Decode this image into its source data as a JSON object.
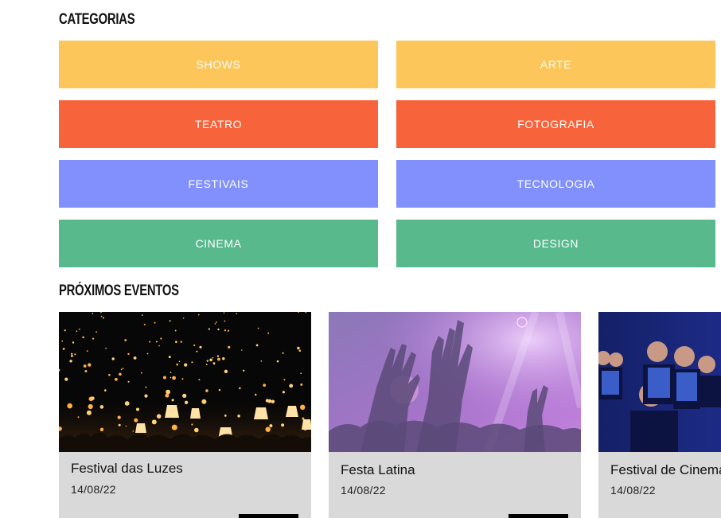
{
  "categories_section": {
    "title": "CATEGORIAS",
    "items": [
      {
        "label": "SHOWS",
        "color": "#fdc65a"
      },
      {
        "label": "ARTE",
        "color": "#fdc65a"
      },
      {
        "label": "TEATRO",
        "color": "#f7633a"
      },
      {
        "label": "FOTOGRAFIA",
        "color": "#f7633a"
      },
      {
        "label": "FESTIVAIS",
        "color": "#8190fd"
      },
      {
        "label": "TECNOLOGIA",
        "color": "#8190fd"
      },
      {
        "label": "CINEMA",
        "color": "#58b98c"
      },
      {
        "label": "DESIGN",
        "color": "#58b98c"
      }
    ]
  },
  "events_section": {
    "title": "PRÓXIMOS EVENTOS",
    "events": [
      {
        "name": "Festival das Luzes",
        "date": "14/08/22",
        "image": "sky-lanterns-photo"
      },
      {
        "name": "Festa Latina",
        "date": "14/08/22",
        "image": "concert-crowd-photo"
      },
      {
        "name": "Festival de Cinema",
        "date": "14/08/22",
        "image": "cinema-audience-photo"
      }
    ]
  }
}
